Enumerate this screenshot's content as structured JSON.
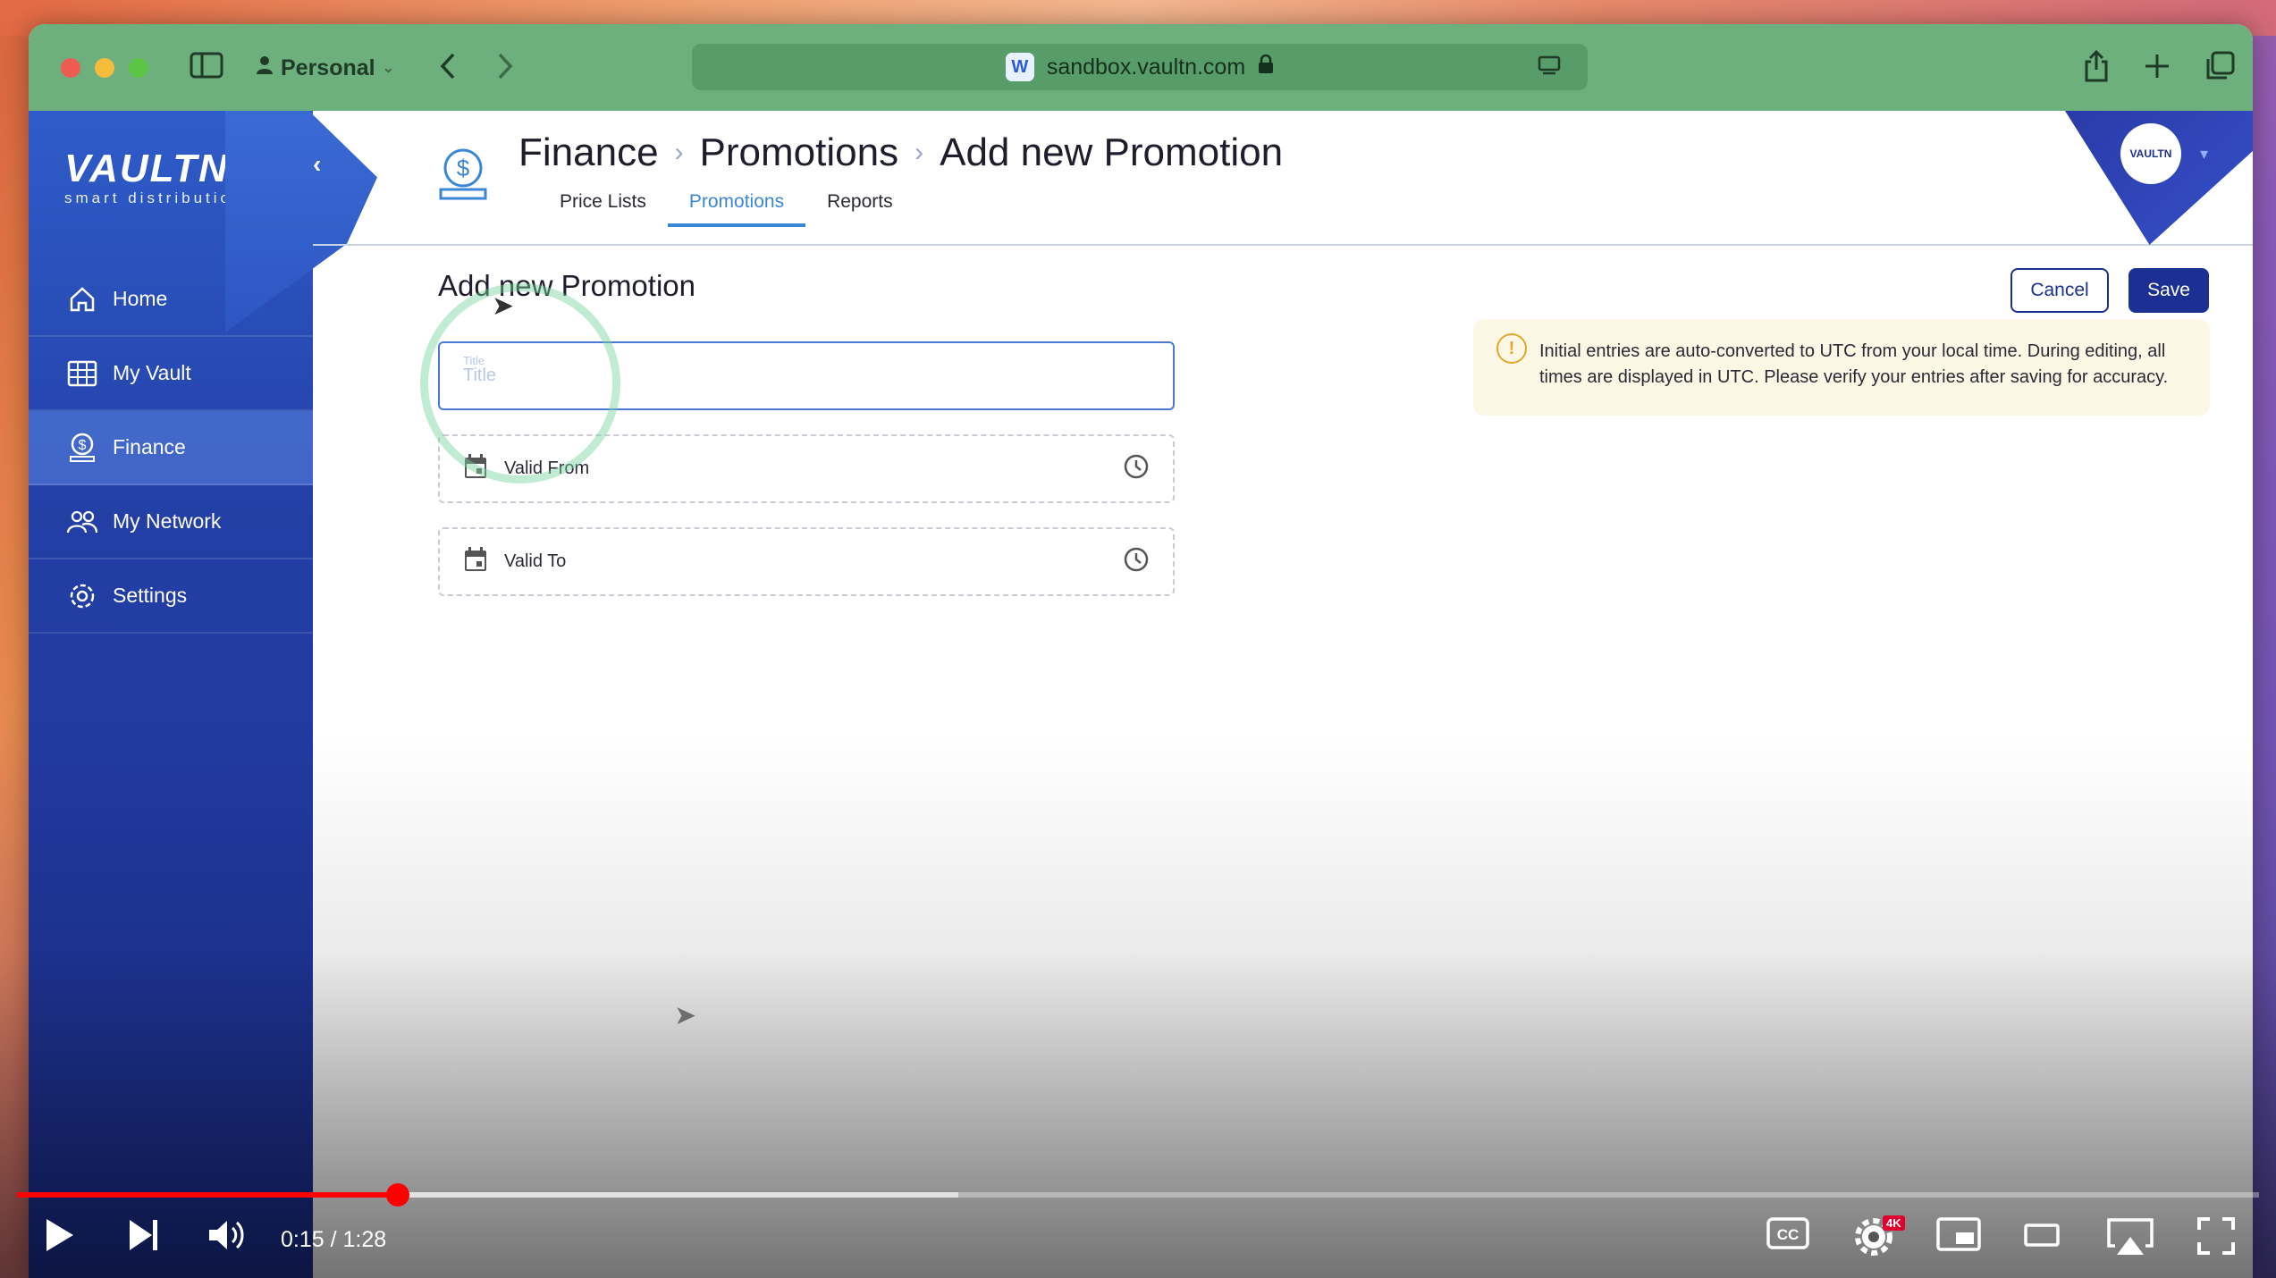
{
  "browser": {
    "profile": "Personal",
    "url": "sandbox.vaultn.com"
  },
  "app": {
    "logo_word": "VAULTN",
    "logo_sub": "smart distribution",
    "sidebar": {
      "items": [
        {
          "label": "Home",
          "icon": "home-icon"
        },
        {
          "label": "My Vault",
          "icon": "grid-icon"
        },
        {
          "label": "Finance",
          "icon": "dollar-coin-icon",
          "active": true
        },
        {
          "label": "My Network",
          "icon": "people-icon"
        },
        {
          "label": "Settings",
          "icon": "gear-icon"
        }
      ]
    },
    "breadcrumb": [
      "Finance",
      "Promotions",
      "Add new Promotion"
    ],
    "tabs": [
      {
        "label": "Price Lists"
      },
      {
        "label": "Promotions",
        "active": true
      },
      {
        "label": "Reports"
      }
    ],
    "avatar_text": "VAULTN"
  },
  "form": {
    "heading": "Add new Promotion",
    "title_field": {
      "floating_label": "Title",
      "placeholder": "Title"
    },
    "valid_from_label": "Valid From",
    "valid_to_label": "Valid To",
    "cancel_label": "Cancel",
    "save_label": "Save",
    "notice": "Initial entries are auto-converted to UTC from your local time. During editing, all times are displayed in UTC. Please verify your entries after saving for accuracy."
  },
  "player": {
    "time": "0:15 / 1:28",
    "quality_badge": "4K",
    "progress_fraction": 0.17,
    "buffer_fraction": 0.42
  },
  "colors": {
    "browser_toolbar": "#6db07d",
    "sidebar": "#233fa6",
    "accent": "#3b86d6",
    "primary_button": "#1c2f92",
    "notice_bg": "#fdf8e6",
    "progress": "#ff0000"
  }
}
